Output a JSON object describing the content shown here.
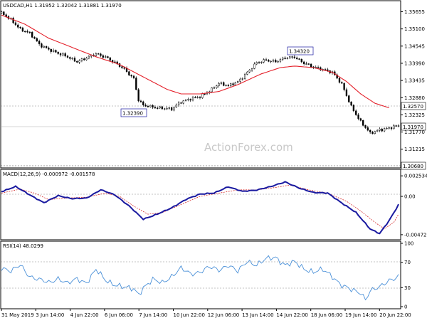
{
  "chart_data": [
    {
      "panel": "price",
      "type": "candlestick",
      "title": "USDCAD,H1  1.31952 1.32042 1.31881 1.31970",
      "watermark": "ActionForex.com",
      "ylim": [
        1.3068,
        1.3585
      ],
      "yticks": [
        "1.35655",
        "1.35100",
        "1.34545",
        "1.33990",
        "1.33435",
        "1.32880",
        "1.32325",
        "1.31770",
        "1.31215"
      ],
      "last_price_label": "1.31970",
      "resistance_label": "1.32570",
      "bottom_label": "1.30680",
      "annotations": [
        {
          "text": "1.34320",
          "value": 1.3432
        },
        {
          "text": "1.32390",
          "value": 1.3239
        }
      ],
      "close_anchor_series": [
        [
          0,
          1.356
        ],
        [
          4,
          1.354
        ],
        [
          8,
          1.351
        ],
        [
          12,
          1.3495
        ],
        [
          16,
          1.346
        ],
        [
          20,
          1.3445
        ],
        [
          24,
          1.343
        ],
        [
          28,
          1.342
        ],
        [
          32,
          1.3405
        ],
        [
          36,
          1.3415
        ],
        [
          40,
          1.343
        ],
        [
          44,
          1.342
        ],
        [
          48,
          1.34
        ],
        [
          52,
          1.338
        ],
        [
          56,
          1.335
        ],
        [
          58,
          1.328
        ],
        [
          60,
          1.3262
        ],
        [
          64,
          1.3258
        ],
        [
          68,
          1.3255
        ],
        [
          72,
          1.325
        ],
        [
          76,
          1.3275
        ],
        [
          80,
          1.3285
        ],
        [
          84,
          1.329
        ],
        [
          88,
          1.331
        ],
        [
          92,
          1.3335
        ],
        [
          96,
          1.3325
        ],
        [
          100,
          1.334
        ],
        [
          104,
          1.337
        ],
        [
          108,
          1.34
        ],
        [
          112,
          1.341
        ],
        [
          116,
          1.3405
        ],
        [
          120,
          1.3415
        ],
        [
          124,
          1.342
        ],
        [
          128,
          1.34
        ],
        [
          132,
          1.3385
        ],
        [
          136,
          1.338
        ],
        [
          140,
          1.337
        ],
        [
          144,
          1.333
        ],
        [
          148,
          1.326
        ],
        [
          152,
          1.321
        ],
        [
          156,
          1.3172
        ],
        [
          160,
          1.3185
        ],
        [
          164,
          1.319
        ],
        [
          168,
          1.3197
        ]
      ],
      "ma_anchor_series": [
        [
          0,
          1.3555
        ],
        [
          10,
          1.3525
        ],
        [
          20,
          1.348
        ],
        [
          30,
          1.345
        ],
        [
          40,
          1.342
        ],
        [
          50,
          1.3395
        ],
        [
          60,
          1.3355
        ],
        [
          70,
          1.3315
        ],
        [
          76,
          1.33
        ],
        [
          84,
          1.33
        ],
        [
          92,
          1.3308
        ],
        [
          100,
          1.333
        ],
        [
          110,
          1.3365
        ],
        [
          118,
          1.3385
        ],
        [
          124,
          1.339
        ],
        [
          132,
          1.3385
        ],
        [
          140,
          1.337
        ],
        [
          146,
          1.334
        ],
        [
          152,
          1.33
        ],
        [
          158,
          1.327
        ],
        [
          164,
          1.3255
        ]
      ]
    },
    {
      "panel": "macd",
      "type": "line",
      "title": "MACD(12,26,9) -0.000972 -0.001578",
      "ylim": [
        -0.005,
        0.0029
      ],
      "yticks": [
        "0.002534",
        "0.00",
        "-0.004727"
      ],
      "macd_anchor_series": [
        [
          0,
          0.0006
        ],
        [
          6,
          0.0012
        ],
        [
          12,
          0.0002
        ],
        [
          18,
          -0.0008
        ],
        [
          24,
          0.0001
        ],
        [
          30,
          -0.0003
        ],
        [
          36,
          -0.0002
        ],
        [
          42,
          0.0008
        ],
        [
          48,
          0.0002
        ],
        [
          54,
          -0.0012
        ],
        [
          60,
          -0.0028
        ],
        [
          66,
          -0.0022
        ],
        [
          72,
          -0.0014
        ],
        [
          78,
          -0.0004
        ],
        [
          84,
          0.0003
        ],
        [
          90,
          0.0004
        ],
        [
          96,
          0.0012
        ],
        [
          102,
          0.0006
        ],
        [
          108,
          0.0008
        ],
        [
          114,
          0.0012
        ],
        [
          120,
          0.0018
        ],
        [
          126,
          0.001
        ],
        [
          132,
          0.0005
        ],
        [
          138,
          0.0004
        ],
        [
          144,
          -0.0008
        ],
        [
          150,
          -0.002
        ],
        [
          156,
          -0.004
        ],
        [
          160,
          -0.0046
        ],
        [
          164,
          -0.003
        ],
        [
          168,
          -0.001
        ]
      ],
      "signal_anchor_series": [
        [
          0,
          0.0004
        ],
        [
          8,
          0.0009
        ],
        [
          14,
          0.0004
        ],
        [
          20,
          -0.0004
        ],
        [
          28,
          -0.0002
        ],
        [
          36,
          -0.0001
        ],
        [
          44,
          0.0004
        ],
        [
          50,
          0.0
        ],
        [
          56,
          -0.0012
        ],
        [
          62,
          -0.0022
        ],
        [
          68,
          -0.002
        ],
        [
          76,
          -0.001
        ],
        [
          84,
          0.0
        ],
        [
          92,
          0.0004
        ],
        [
          100,
          0.0008
        ],
        [
          108,
          0.0008
        ],
        [
          116,
          0.0011
        ],
        [
          122,
          0.0014
        ],
        [
          130,
          0.0008
        ],
        [
          138,
          0.0004
        ],
        [
          146,
          -0.0006
        ],
        [
          152,
          -0.0018
        ],
        [
          158,
          -0.0032
        ],
        [
          162,
          -0.004
        ],
        [
          166,
          -0.0032
        ],
        [
          168,
          -0.0022
        ]
      ]
    },
    {
      "panel": "rsi",
      "type": "line",
      "title": "RSI(14) 48.0299",
      "ylim": [
        0,
        100
      ],
      "yticks": [
        "100",
        "70",
        "30",
        "0"
      ],
      "levels": [
        70,
        30
      ],
      "rsi_anchor_series": [
        [
          0,
          62
        ],
        [
          4,
          55
        ],
        [
          8,
          66
        ],
        [
          12,
          48
        ],
        [
          16,
          42
        ],
        [
          20,
          38
        ],
        [
          24,
          45
        ],
        [
          28,
          36
        ],
        [
          32,
          44
        ],
        [
          36,
          38
        ],
        [
          40,
          58
        ],
        [
          44,
          42
        ],
        [
          48,
          35
        ],
        [
          52,
          30
        ],
        [
          56,
          28
        ],
        [
          58,
          20
        ],
        [
          60,
          30
        ],
        [
          64,
          42
        ],
        [
          68,
          38
        ],
        [
          72,
          48
        ],
        [
          76,
          60
        ],
        [
          80,
          52
        ],
        [
          84,
          55
        ],
        [
          88,
          62
        ],
        [
          92,
          58
        ],
        [
          96,
          66
        ],
        [
          100,
          55
        ],
        [
          104,
          72
        ],
        [
          108,
          66
        ],
        [
          112,
          75
        ],
        [
          116,
          78
        ],
        [
          120,
          66
        ],
        [
          124,
          70
        ],
        [
          128,
          60
        ],
        [
          132,
          55
        ],
        [
          136,
          58
        ],
        [
          140,
          48
        ],
        [
          144,
          34
        ],
        [
          148,
          26
        ],
        [
          152,
          22
        ],
        [
          154,
          12
        ],
        [
          156,
          25
        ],
        [
          160,
          30
        ],
        [
          164,
          42
        ],
        [
          168,
          48
        ]
      ]
    }
  ],
  "x_axis_labels": [
    "31 May 2019",
    "3 Jun 14:00",
    "4 Jun 22:00",
    "6 Jun 06:00",
    "7 Jun 14:00",
    "10 Jun 22:00",
    "12 Jun 06:00",
    "13 Jun 14:00",
    "14 Jun 22:00",
    "18 Jun 06:00",
    "19 Jun 14:00",
    "20 Jun 22:00"
  ],
  "colors": {
    "candle": "#000000",
    "ma": "#e4202a",
    "macd": "#1a1aa0",
    "signal": "#d01818",
    "rsi": "#4a90d8",
    "watermark": "#c8c8c8"
  }
}
